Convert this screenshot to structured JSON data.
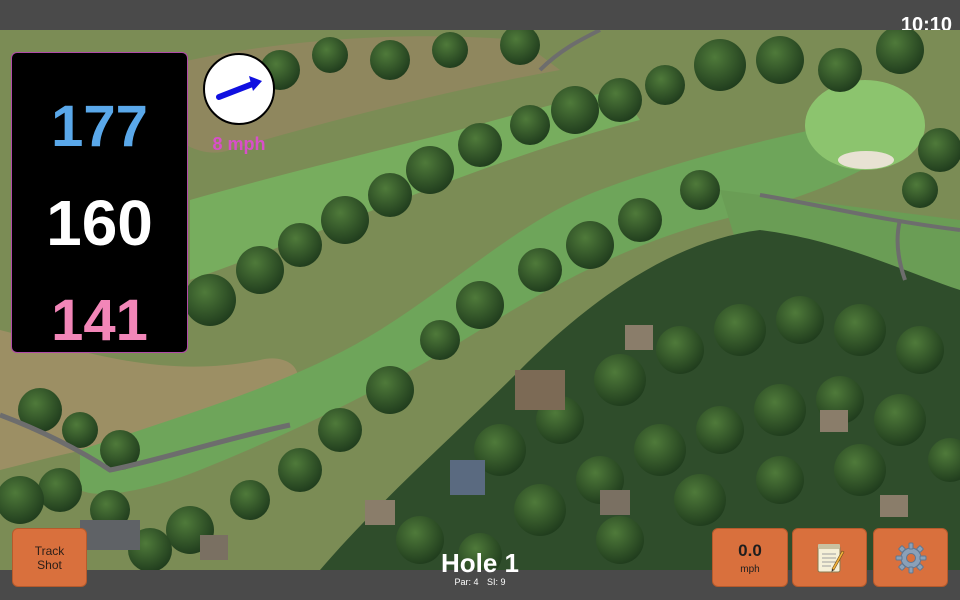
{
  "status": {
    "time": "10:10"
  },
  "distances": {
    "back": "177",
    "center": "160",
    "front": "141"
  },
  "wind": {
    "speed": "8 mph",
    "direction_icon": "arrow-icon"
  },
  "hole": {
    "title": "Hole 1",
    "par": "Par: 4",
    "si": "SI: 9"
  },
  "buttons": {
    "track_shot_line1": "Track",
    "track_shot_line2": "Shot",
    "speed_value": "0.0",
    "speed_unit": "mph",
    "notes_icon": "notepad-icon",
    "settings_icon": "gear-icon"
  },
  "colors": {
    "back": "#5aa8ea",
    "center": "#ffffff",
    "front": "#f286b8",
    "button": "#d9703d",
    "wind": "#d84fc9",
    "arrow": "#1010e0"
  }
}
